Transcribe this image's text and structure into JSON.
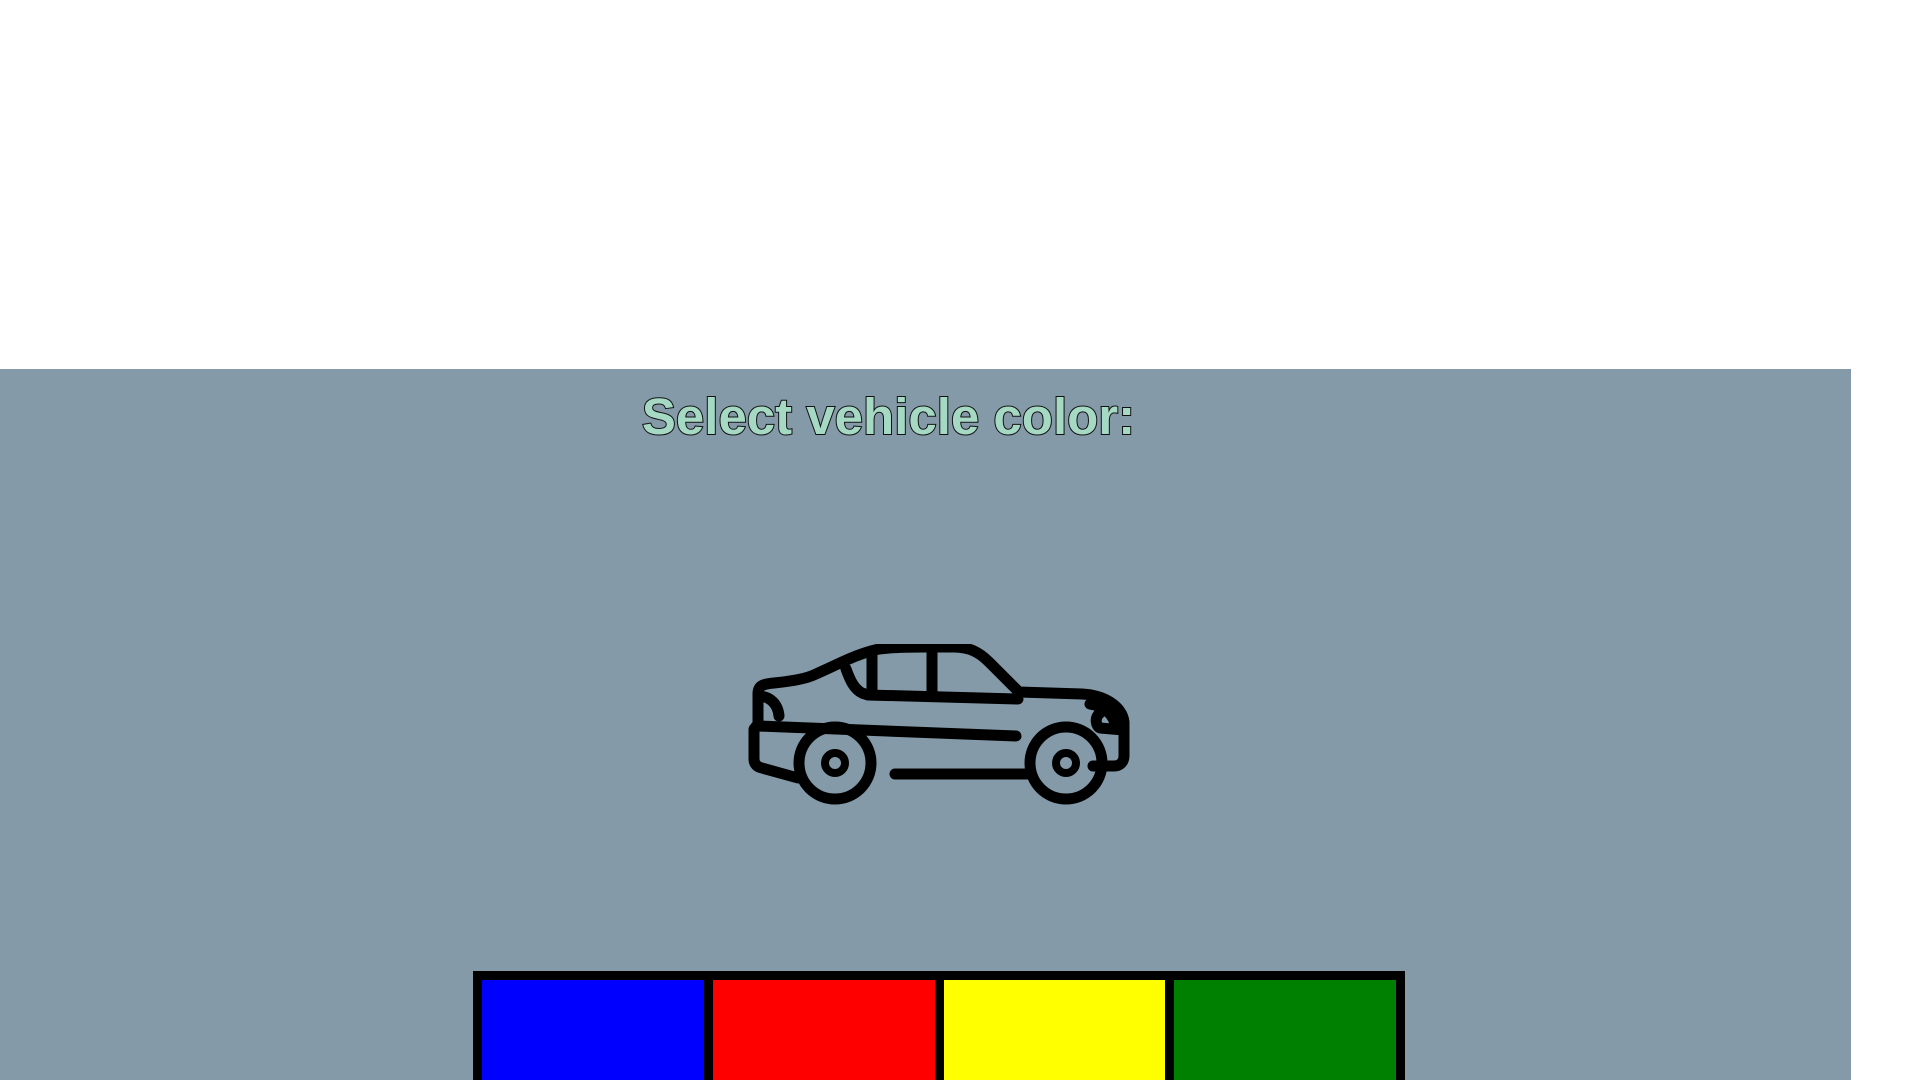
{
  "title": "Select vehicle color:",
  "vehicle_icon": "car-icon",
  "colors": {
    "background_panel": "#849aa8",
    "title_fill": "#a6d9c4"
  },
  "swatches": [
    {
      "name": "blue",
      "color": "#0000ff",
      "label": ""
    },
    {
      "name": "red",
      "color": "#ff0000",
      "label": ""
    },
    {
      "name": "yellow",
      "color": "#ffff00",
      "label": ""
    },
    {
      "name": "green",
      "color": "#008000",
      "label": ""
    }
  ]
}
